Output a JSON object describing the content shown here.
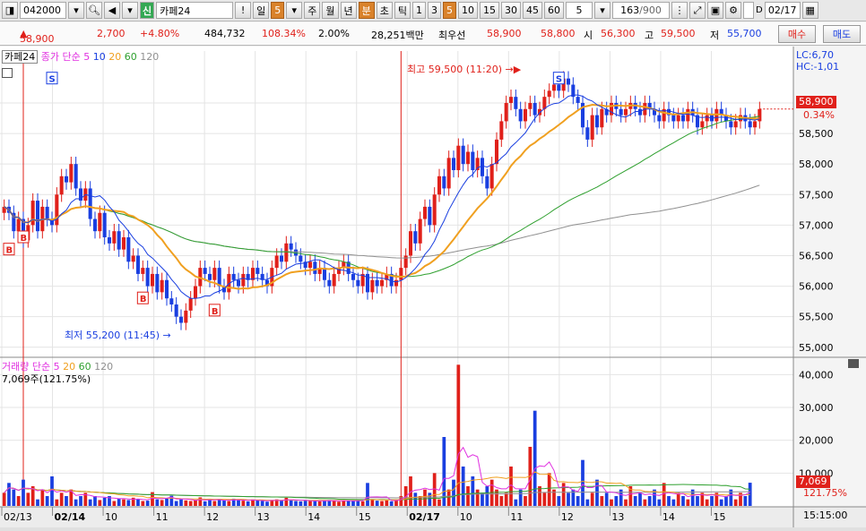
{
  "toolbar": {
    "code": "042000",
    "badge": "신",
    "name": "카페24",
    "period_day": "일",
    "period_num": "5",
    "periods": [
      "주",
      "월",
      "년",
      "분",
      "초",
      "틱"
    ],
    "minutes": [
      "1",
      "3",
      "5",
      "10",
      "15",
      "30",
      "45",
      "60"
    ],
    "select_value": "5",
    "count": "163",
    "count_total": "/900",
    "date": "02/17",
    "check_label": "D"
  },
  "info": {
    "price": "58,900",
    "change": "2,700",
    "change_pct": "+4.80%",
    "volume": "484,732",
    "vol_ratio": "108.34%",
    "turnover": "2.00%",
    "amount": "28,251백만",
    "best_label": "최우선",
    "ask": "58,900",
    "bid": "58,800",
    "open_label": "시",
    "open": "56,300",
    "high_label": "고",
    "high": "59,500",
    "low_label": "저",
    "low": "55,700",
    "buy": "매수",
    "sell": "매도"
  },
  "colors": {
    "up": "#e0201a",
    "down": "#1a3fe0",
    "ma5": "#1a3fe0",
    "ma20": "#f0a020",
    "ma60": "#2fa02f",
    "ma120": "#909090",
    "vma5": "#e030e0",
    "vma20": "#f0a020",
    "vma60": "#2fa02f",
    "vma120": "#909090",
    "volume_up": "#e0201a",
    "volume_down": "#1a3fe0"
  },
  "price_legend": {
    "name": "카페24",
    "price_type": "종가",
    "ma_type": "단순",
    "p5": "5",
    "p10": "10",
    "p20": "20",
    "p60": "60",
    "p120": "120"
  },
  "volume_legend": {
    "name": "거래량",
    "ma_type": "단순",
    "p5": "5",
    "p20": "20",
    "p60": "60",
    "p120": "120",
    "value": "7,069주(121.75%)"
  },
  "annotations": {
    "high": "최고 59,500 (11:20)",
    "low": "최저 55,200 (11:45)",
    "lc": "LC:6,70",
    "hc": "HC:-1,01",
    "price_tag": "58,900",
    "price_pct": "0.34%",
    "vol_tag": "7,069",
    "vol_pct": "121.75%"
  },
  "time_label": "15:15:00",
  "chart_data": [
    {
      "type": "candlestick",
      "yticks": [
        55000,
        55500,
        56000,
        56500,
        57000,
        57500,
        58000,
        58500,
        59000
      ],
      "ytick_labels": [
        "55,000",
        "55,500",
        "56,000",
        "56,500",
        "57,000",
        "57,500",
        "58,000",
        "58,500",
        "59,000"
      ],
      "ylim": [
        54850,
        59850
      ],
      "x_labels": [
        "02/13",
        "02/14",
        "10",
        "11",
        "12",
        "13",
        "14",
        "15",
        "02/17",
        "10",
        "11",
        "12",
        "13",
        "14",
        "15"
      ],
      "session_break_label": "02/17",
      "closes": [
        57300,
        57200,
        56900,
        57100,
        56750,
        57000,
        57400,
        56900,
        57300,
        57100,
        57000,
        57500,
        57800,
        57700,
        58000,
        57600,
        57400,
        57600,
        57100,
        56900,
        57200,
        56800,
        56700,
        56900,
        56600,
        56800,
        56400,
        56500,
        56200,
        56300,
        56000,
        56200,
        55900,
        56100,
        55800,
        55700,
        55500,
        55400,
        55600,
        55800,
        56000,
        56300,
        56200,
        56100,
        56300,
        56000,
        55900,
        56200,
        56100,
        56000,
        56200,
        56100,
        56300,
        56200,
        56100,
        56000,
        56300,
        56500,
        56400,
        56700,
        56600,
        56500,
        56400,
        56300,
        56400,
        56200,
        56300,
        56100,
        56000,
        56200,
        56300,
        56400,
        56200,
        56100,
        56000,
        56200,
        55900,
        56100,
        56000,
        56100,
        56200,
        56000,
        56100,
        56300,
        56500,
        56900,
        56700,
        57100,
        57300,
        57000,
        57500,
        57800,
        57600,
        58100,
        57900,
        58300,
        58000,
        58200,
        57900,
        58100,
        57800,
        57600,
        58000,
        58400,
        58700,
        59000,
        59100,
        58900,
        58700,
        58900,
        59000,
        58800,
        58900,
        59100,
        59200,
        59300,
        59200,
        59400,
        59300,
        59100,
        59000,
        58600,
        58400,
        58800,
        58600,
        58900,
        58800,
        59000,
        58900,
        58800,
        58900,
        59000,
        58900,
        58800,
        59000,
        58900,
        58800,
        58700,
        58900,
        58800,
        58700,
        58800,
        58700,
        58900,
        58800,
        58600,
        58700,
        58800,
        58700,
        58900,
        58800,
        58700,
        58600,
        58700,
        58800,
        58700,
        58600,
        58700,
        58900
      ],
      "volumes": [
        4000,
        7000,
        5000,
        3000,
        8000,
        4000,
        6000,
        2000,
        5000,
        3000,
        9000,
        2000,
        4000,
        3000,
        5000,
        2000,
        3000,
        4000,
        2000,
        3000,
        1800,
        2500,
        3000,
        1500,
        2200,
        2000,
        1800,
        2500,
        2000,
        1500,
        1600,
        4200,
        2000,
        1800,
        2200,
        3100,
        1500,
        2000,
        1700,
        1500,
        1800,
        2600,
        1400,
        1900,
        1500,
        2100,
        1700,
        1500,
        2200,
        1800,
        1600,
        1400,
        2000,
        1700,
        1500,
        1300,
        1800,
        2000,
        1600,
        2500,
        1700,
        1500,
        1400,
        1600,
        1700,
        1500,
        1400,
        1600,
        1800,
        1500,
        1300,
        1700,
        1600,
        1500,
        1800,
        1400,
        7000,
        2000,
        1600,
        1500,
        1700,
        1400,
        2000,
        3000,
        6000,
        9000,
        4000,
        3000,
        5000,
        4000,
        10000,
        2000,
        21000,
        5000,
        8000,
        43000,
        12000,
        6000,
        9000,
        5000,
        4000,
        6000,
        8000,
        5000,
        3000,
        4000,
        12000,
        2000,
        5000,
        3000,
        18000,
        29000,
        6000,
        4000,
        10000,
        5000,
        3000,
        7000,
        4000,
        5000,
        3000,
        14000,
        2000,
        4000,
        8000,
        3000,
        4000,
        2000,
        3000,
        5000,
        2000,
        6000,
        3000,
        4000,
        2000,
        3000,
        5000,
        2000,
        7000,
        3000,
        2000,
        4000,
        3000,
        2000,
        5000,
        3000,
        4000,
        2000,
        3000,
        4000,
        2000,
        3000,
        5000,
        2000,
        4000,
        3000,
        7069
      ]
    },
    {
      "type": "bar",
      "yticks": [
        10000,
        20000,
        30000,
        40000
      ],
      "ytick_labels": [
        "10,000",
        "20,000",
        "30,000",
        "40,000"
      ],
      "ylim": [
        0,
        45000
      ]
    }
  ]
}
